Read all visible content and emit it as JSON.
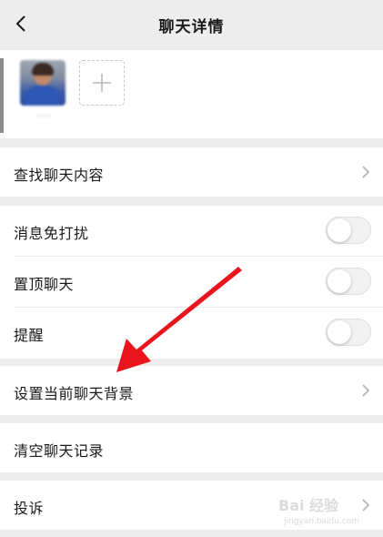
{
  "header": {
    "title": "聊天详情",
    "back_icon": "chevron-left-icon"
  },
  "members": {
    "items": [
      {
        "name": "·····",
        "avatar": "user-photo"
      }
    ],
    "add_icon": "plus-icon"
  },
  "rows": {
    "search": {
      "label": "查找聊天内容"
    },
    "mute": {
      "label": "消息免打扰",
      "on": false
    },
    "pin": {
      "label": "置顶聊天",
      "on": false
    },
    "remind": {
      "label": "提醒",
      "on": false
    },
    "background": {
      "label": "设置当前聊天背景"
    },
    "clear": {
      "label": "清空聊天记录"
    },
    "report": {
      "label": "投诉"
    }
  },
  "annotation": {
    "arrow_color": "#e8151d",
    "target": "background"
  },
  "watermark": {
    "text": "Bai 经验",
    "url": "jingyan.baidu.com"
  },
  "colors": {
    "page_bg": "#ededed",
    "row_bg": "#ffffff",
    "toggle_off": "#f2f2f2"
  }
}
